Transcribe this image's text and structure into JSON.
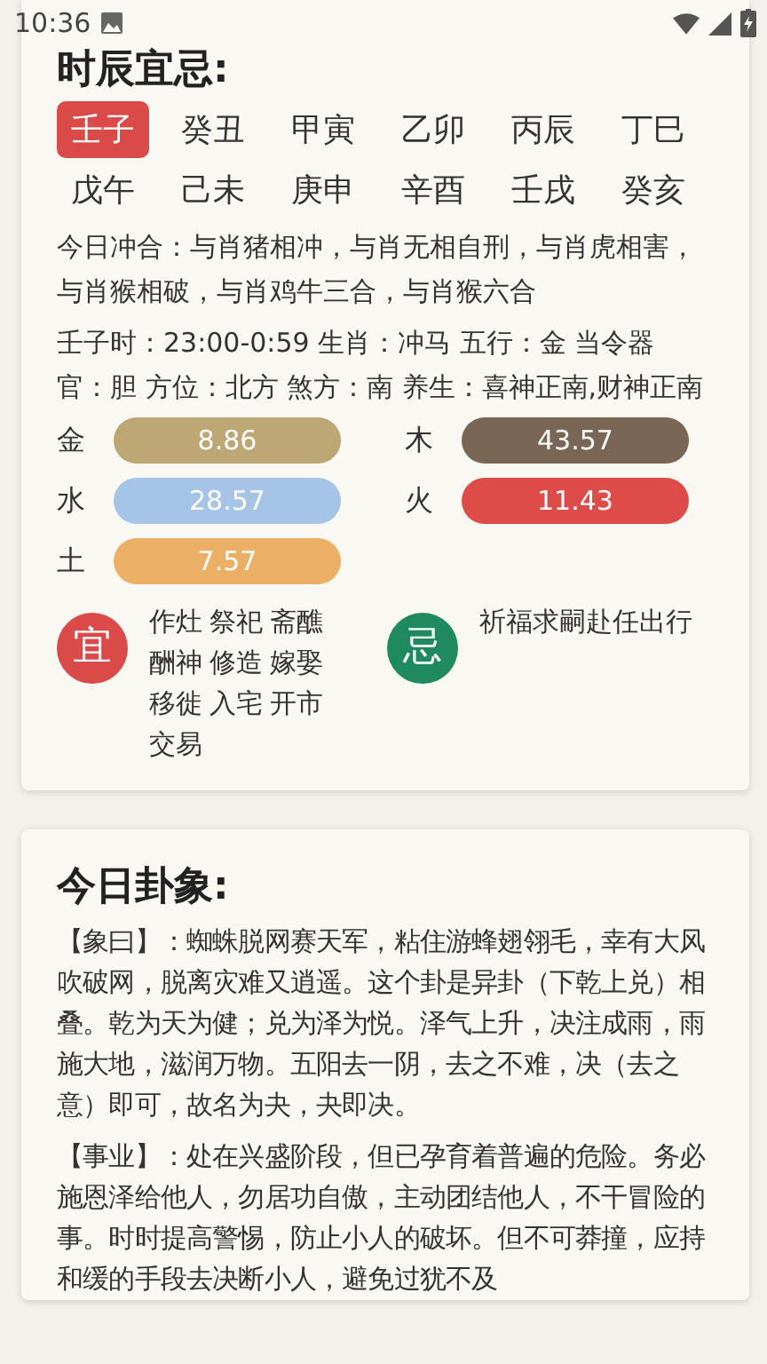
{
  "status_bar": {
    "time": "10:36"
  },
  "hours_card": {
    "title": "时辰宜忌:",
    "tabs": [
      {
        "label": "壬子",
        "selected": true
      },
      {
        "label": "癸丑",
        "selected": false
      },
      {
        "label": "甲寅",
        "selected": false
      },
      {
        "label": "乙卯",
        "selected": false
      },
      {
        "label": "丙辰",
        "selected": false
      },
      {
        "label": "丁巳",
        "selected": false
      },
      {
        "label": "戊午",
        "selected": false
      },
      {
        "label": "己未",
        "selected": false
      },
      {
        "label": "庚申",
        "selected": false
      },
      {
        "label": "辛酉",
        "selected": false
      },
      {
        "label": "壬戌",
        "selected": false
      },
      {
        "label": "癸亥",
        "selected": false
      }
    ],
    "clash_text": "今日冲合：与肖猪相冲，与肖无相自刑，与肖虎相害，与肖猴相破，与肖鸡牛三合，与肖猴六合",
    "hour_info": "壬子时：23:00-0:59 生肖：冲马 五行：金 当令器官：胆 方位：北方 煞方：南 养生：喜神正南,财神正南",
    "elements": [
      {
        "label": "金",
        "value": "8.86",
        "color": "#bda774"
      },
      {
        "label": "木",
        "value": "43.57",
        "color": "#7a6654"
      },
      {
        "label": "水",
        "value": "28.57",
        "color": "#a5c4e6"
      },
      {
        "label": "火",
        "value": "11.43",
        "color": "#de4c4a"
      },
      {
        "label": "土",
        "value": "7.57",
        "color": "#ecaf66"
      }
    ],
    "advice": [
      {
        "badge": "宜",
        "color": "#d94a48",
        "items": [
          "作灶",
          "祭祀",
          "斋醮",
          "酬神",
          "修造",
          "嫁娶",
          "移徙",
          "入宅",
          "开市",
          "交易"
        ]
      },
      {
        "badge": "忌",
        "color": "#1f8a5f",
        "items": [
          "祈福求嗣赴任出行"
        ]
      }
    ]
  },
  "hexagram_card": {
    "title": "今日卦象:",
    "paragraphs": [
      "【象曰】：蜘蛛脱网赛天军，粘住游蜂翅翎毛，幸有大风吹破网，脱离灾难又逍遥。这个卦是异卦（下乾上兑）相叠。乾为天为健；兑为泽为悦。泽气上升，决注成雨，雨施大地，滋润万物。五阳去一阴，去之不难，决（去之意）即可，故名为夬，夬即决。",
      "【事业】：处在兴盛阶段，但已孕育着普遍的危险。务必施恩泽给他人，勿居功自傲，主动团结他人，不干冒险的事。时时提高警惕，防止小人的破坏。但不可莽撞，应持和缓的手段去决断小人，避免过犹不及"
    ]
  }
}
